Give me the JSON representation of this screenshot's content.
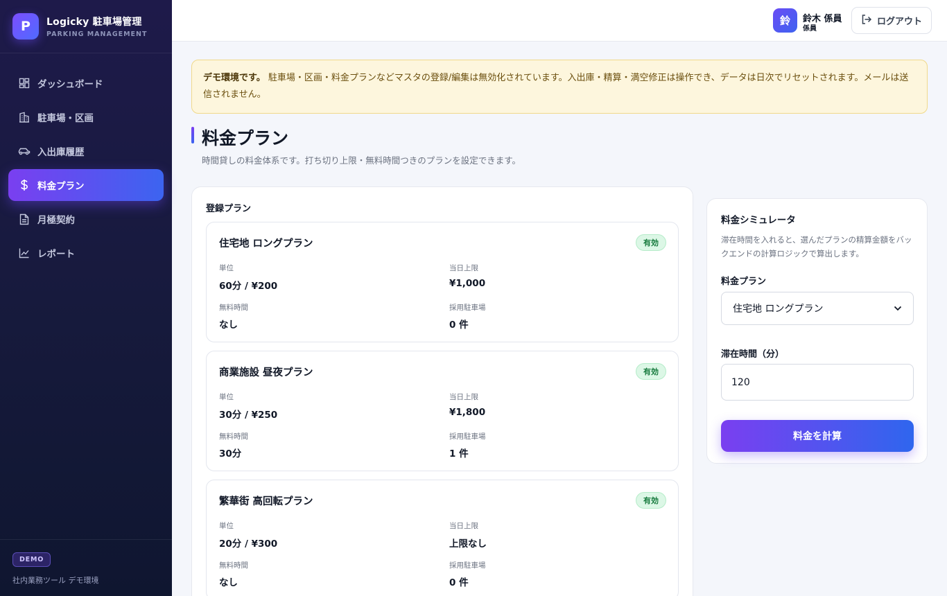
{
  "brand": {
    "logo_letter": "P",
    "title": "Logicky 駐車場管理",
    "subtitle": "PARKING MANAGEMENT"
  },
  "nav": [
    {
      "label": "ダッシュボード",
      "icon": "dashboard-icon",
      "active": false
    },
    {
      "label": "駐車場・区画",
      "icon": "building-icon",
      "active": false
    },
    {
      "label": "入出庫履歴",
      "icon": "car-icon",
      "active": false
    },
    {
      "label": "料金プラン",
      "icon": "dollar-icon",
      "active": true
    },
    {
      "label": "月極契約",
      "icon": "document-icon",
      "active": false
    },
    {
      "label": "レポート",
      "icon": "chart-icon",
      "active": false
    }
  ],
  "sidebar_footer": {
    "badge": "DEMO",
    "text": "社内業務ツール デモ環境"
  },
  "topbar": {
    "avatar_text": "鈴",
    "user_name": "鈴木 係員",
    "user_role": "係員",
    "logout_label": "ログアウト"
  },
  "notice": {
    "strong": "デモ環境です。",
    "text": "駐車場・区画・料金プランなどマスタの登録/編集は無効化されています。入出庫・精算・満空修正は操作でき、データは日次でリセットされます。メールは送信されません。"
  },
  "page": {
    "title": "料金プラン",
    "description": "時間貸しの料金体系です。打ち切り上限・無料時間つきのプランを設定できます。"
  },
  "plans_section": {
    "title": "登録プラン",
    "labels": {
      "unit": "単位",
      "daily_max": "当日上限",
      "free_time": "無料時間",
      "lots": "採用駐車場"
    },
    "plans": [
      {
        "name": "住宅地 ロングプラン",
        "status": "有効",
        "unit": "60分 / ¥200",
        "daily_max": "¥1,000",
        "free_time": "なし",
        "lots": "0 件"
      },
      {
        "name": "商業施設 昼夜プラン",
        "status": "有効",
        "unit": "30分 / ¥250",
        "daily_max": "¥1,800",
        "free_time": "30分",
        "lots": "1 件"
      },
      {
        "name": "繁華街 高回転プラン",
        "status": "有効",
        "unit": "20分 / ¥300",
        "daily_max": "上限なし",
        "free_time": "なし",
        "lots": "0 件"
      }
    ]
  },
  "simulator": {
    "title": "料金シミュレータ",
    "description": "滞在時間を入れると、選んだプランの精算金額をバックエンドの計算ロジックで算出します。",
    "plan_label": "料金プラン",
    "plan_selected": "住宅地 ロングプラン",
    "duration_label": "滞在時間（分）",
    "duration_value": "120",
    "button_label": "料金を計算"
  },
  "colors": {
    "accent_start": "#7a3ff0",
    "accent_end": "#3c64f0",
    "active_badge": "#167a3d",
    "notice_bg": "#fdf6dd"
  }
}
